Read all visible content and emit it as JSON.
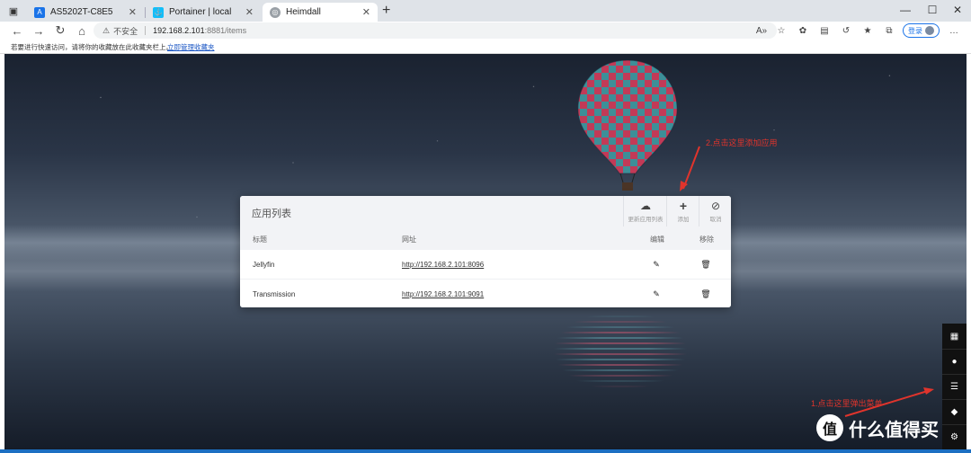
{
  "browser": {
    "tabs": [
      {
        "title": "AS5202T-C8E5",
        "favicon_color": "#1a73e8"
      },
      {
        "title": "Portainer | local",
        "favicon_color": "#13bef9"
      },
      {
        "title": "Heimdall",
        "favicon_color": "#9aa0a6",
        "active": true
      }
    ],
    "window_controls": {
      "minimize": "—",
      "maximize": "☐",
      "close": "✕"
    },
    "address": {
      "security_label": "不安全",
      "host": "192.168.2.101",
      "path": ":8881/items"
    },
    "login_label": "登录",
    "bookmarks_tip": "若要进行快速访问，请将你的收藏放在此收藏夹栏上。",
    "bookmarks_link": "立即管理收藏夹"
  },
  "panel": {
    "title": "应用列表",
    "actions": [
      {
        "label": "更新应用列表",
        "icon": "cloud-download-icon"
      },
      {
        "label": "添加",
        "icon": "plus-icon"
      },
      {
        "label": "取消",
        "icon": "ban-icon"
      }
    ],
    "columns": {
      "title": "标题",
      "url": "网址",
      "edit": "编辑",
      "delete": "移除"
    },
    "rows": [
      {
        "title": "Jellyfin",
        "url": "http://192.168.2.101:8096"
      },
      {
        "title": "Transmission",
        "url": "http://192.168.2.101:9091"
      }
    ]
  },
  "side_menu": [
    {
      "icon": "grid-icon"
    },
    {
      "icon": "user-icon"
    },
    {
      "icon": "list-icon"
    },
    {
      "icon": "tag-icon"
    }
  ],
  "annotations": {
    "add_hint": "2.点击这里添加应用",
    "menu_hint": "1.点击这里弹出菜单",
    "color": "#e0342c"
  },
  "watermark": {
    "logo": "值",
    "text": "什么值得买"
  }
}
